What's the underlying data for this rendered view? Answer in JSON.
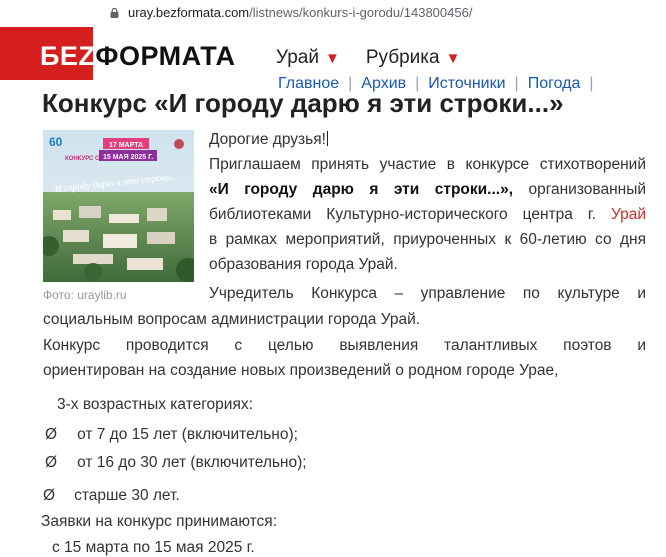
{
  "browser": {
    "url_domain": "uray.bezformata.com",
    "url_path": "/listnews/konkurs-i-gorodu/143800456/"
  },
  "site": {
    "logo_red": "БЕZ",
    "logo_dark": "ФОРМАТА",
    "city": "Урай",
    "rubric": "Рубрика",
    "nav": [
      "Главное",
      "Архив",
      "Источники",
      "Погода"
    ]
  },
  "article": {
    "title": "Конкурс «И городу дарю я эти строки...»",
    "photo": {
      "caption": "Фото: uraylib.ru",
      "poster_title": "КОНКУРС СТИХОТВОРЕНИЙ",
      "poster_dates_1": "17 МАРТА",
      "poster_dates_2": "15 МАЯ 2025 Г.",
      "poster_script": "И городу дарю я эти строки...",
      "poster_badge": "60"
    },
    "greeting": "Дорогие друзья!",
    "p1_lines": [
      "Приглашаем принять участие в конкурсе стихотворений",
      "организованный",
      "библиотеками Культурно-исторического центра г.",
      "в рамках мероприятий, приуроченных к 60-летию со дня",
      "образования города Урай."
    ],
    "p1_quote": "«И городу дарю я эти строки...»,",
    "p1_city_link": "Урай",
    "p2_line1": "Учредитель Конкурса – управление по культуре и",
    "p2_line2": "социальным вопросам  администрации  города Урай.",
    "p3_line1": "Конкурс проводится с целью выявления талантливых поэтов и",
    "p3_line2": "ориентирован на создание новых произведений о родном городе Урае,",
    "categories_heading": "3-х возрастных категориях:",
    "bullet_glyph": "Ø",
    "categories": [
      "от 7 до 15 лет (включительно);",
      "от 16 до 30 лет (включительно);",
      "старше 30 лет."
    ],
    "applications_heading": "Заявки на конкурс принимаются:",
    "applications_period": "с 15 марта по 15 мая 2025 г."
  },
  "colors": {
    "brand_red": "#d51f1f",
    "link_blue": "#1a56b5",
    "city_link": "#c7322d"
  }
}
